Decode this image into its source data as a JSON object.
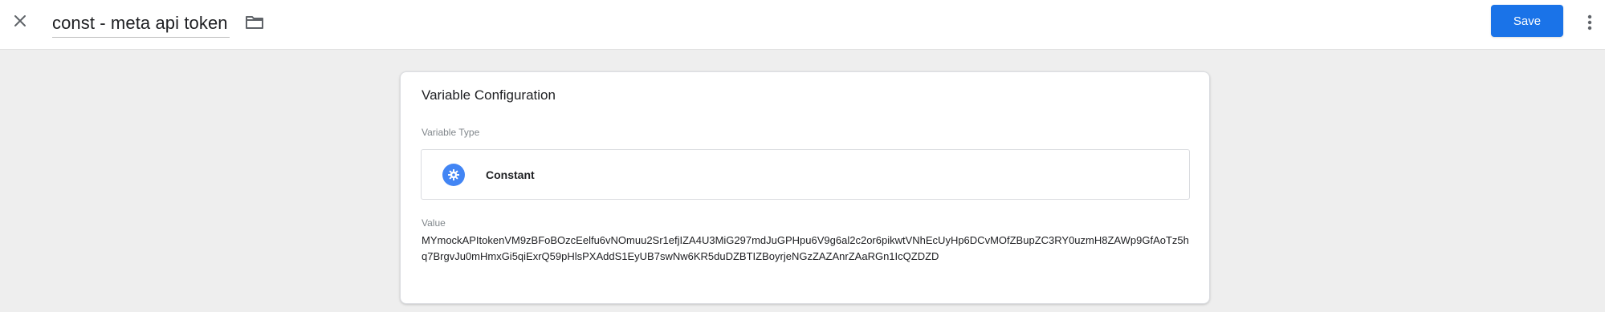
{
  "header": {
    "title": "const - meta api token",
    "save_label": "Save",
    "close_icon": "close-icon",
    "folder_icon": "folder-icon",
    "more_icon": "more-vert-icon"
  },
  "card": {
    "title": "Variable Configuration",
    "variable_type_label": "Variable Type",
    "variable_type": "Constant",
    "variable_type_icon": "gear-icon",
    "value_label": "Value",
    "value": "MYmockAPItokenVM9zBFoBOzcEelfu6vNOmuu2Sr1efjIZA4U3MiG297mdJuGPHpu6V9g6al2c2or6pikwtVNhEcUyHp6DCvMOfZBupZC3RY0uzmH8ZAWp9GfAoTz5hq7BrgvJu0mHmxGi5qiExrQ59pHlsPXAddS1EyUB7swNw6KR5duDZBTIZBoyrjeNGzZAZAnrZAaRGn1IcQZDZD"
  },
  "colors": {
    "accent": "#1a73e8",
    "type_icon_bg": "#4285f4",
    "page_bg": "#eeeeee"
  }
}
